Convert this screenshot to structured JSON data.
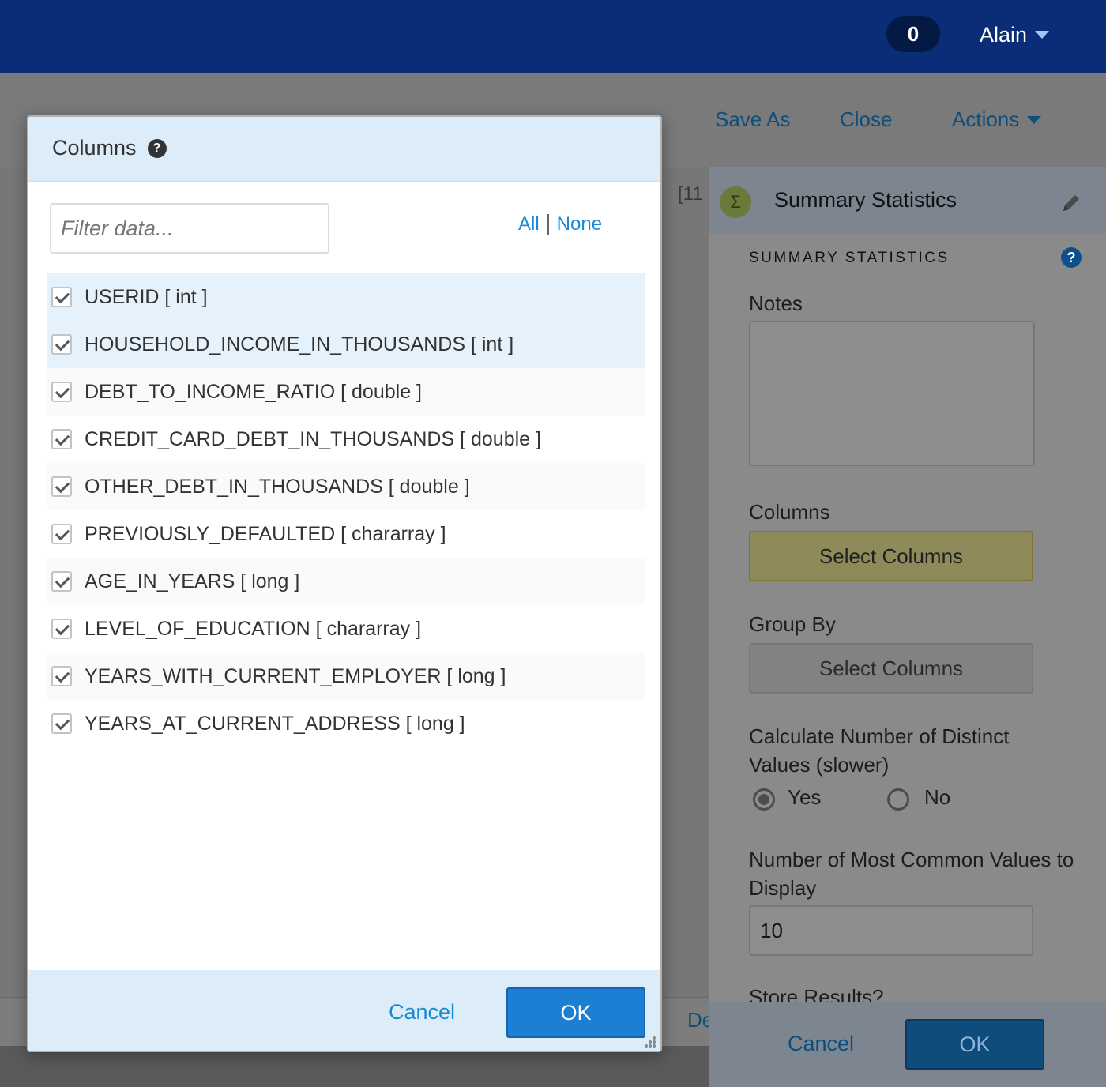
{
  "header": {
    "notification_count": "0",
    "user_name": "Alain"
  },
  "toolbar": {
    "save_as": "Save As",
    "close": "Close",
    "actions": "Actions"
  },
  "background": {
    "partial_text": "[11",
    "partial_link": "De"
  },
  "side_panel": {
    "title": "Summary Statistics",
    "section_title": "SUMMARY STATISTICS",
    "notes_label": "Notes",
    "columns_label": "Columns",
    "columns_button": "Select Columns",
    "group_by_label": "Group By",
    "group_by_button": "Select Columns",
    "distinct_label": "Calculate Number of Distinct Values (slower)",
    "distinct_options": [
      "Yes",
      "No"
    ],
    "distinct_selected": "Yes",
    "common_values_label": "Number of Most Common Values to Display",
    "common_values_value": "10",
    "store_results_label": "Store Results?",
    "cancel": "Cancel",
    "ok": "OK"
  },
  "modal": {
    "title": "Columns",
    "filter_placeholder": "Filter data...",
    "select_all": "All",
    "select_none": "None",
    "columns": [
      {
        "label": "USERID [ int ]",
        "checked": true,
        "highlighted": true
      },
      {
        "label": "HOUSEHOLD_INCOME_IN_THOUSANDS [ int ]",
        "checked": true,
        "highlighted": true
      },
      {
        "label": "DEBT_TO_INCOME_RATIO [ double ]",
        "checked": true,
        "highlighted": false
      },
      {
        "label": "CREDIT_CARD_DEBT_IN_THOUSANDS [ double ]",
        "checked": true,
        "highlighted": false
      },
      {
        "label": "OTHER_DEBT_IN_THOUSANDS [ double ]",
        "checked": true,
        "highlighted": false
      },
      {
        "label": "PREVIOUSLY_DEFAULTED [ chararray ]",
        "checked": true,
        "highlighted": false
      },
      {
        "label": "AGE_IN_YEARS [ long ]",
        "checked": true,
        "highlighted": false
      },
      {
        "label": "LEVEL_OF_EDUCATION [ chararray ]",
        "checked": true,
        "highlighted": false
      },
      {
        "label": "YEARS_WITH_CURRENT_EMPLOYER [ long ]",
        "checked": true,
        "highlighted": false
      },
      {
        "label": "YEARS_AT_CURRENT_ADDRESS [ long ]",
        "checked": true,
        "highlighted": false
      }
    ],
    "cancel": "Cancel",
    "ok": "OK"
  }
}
